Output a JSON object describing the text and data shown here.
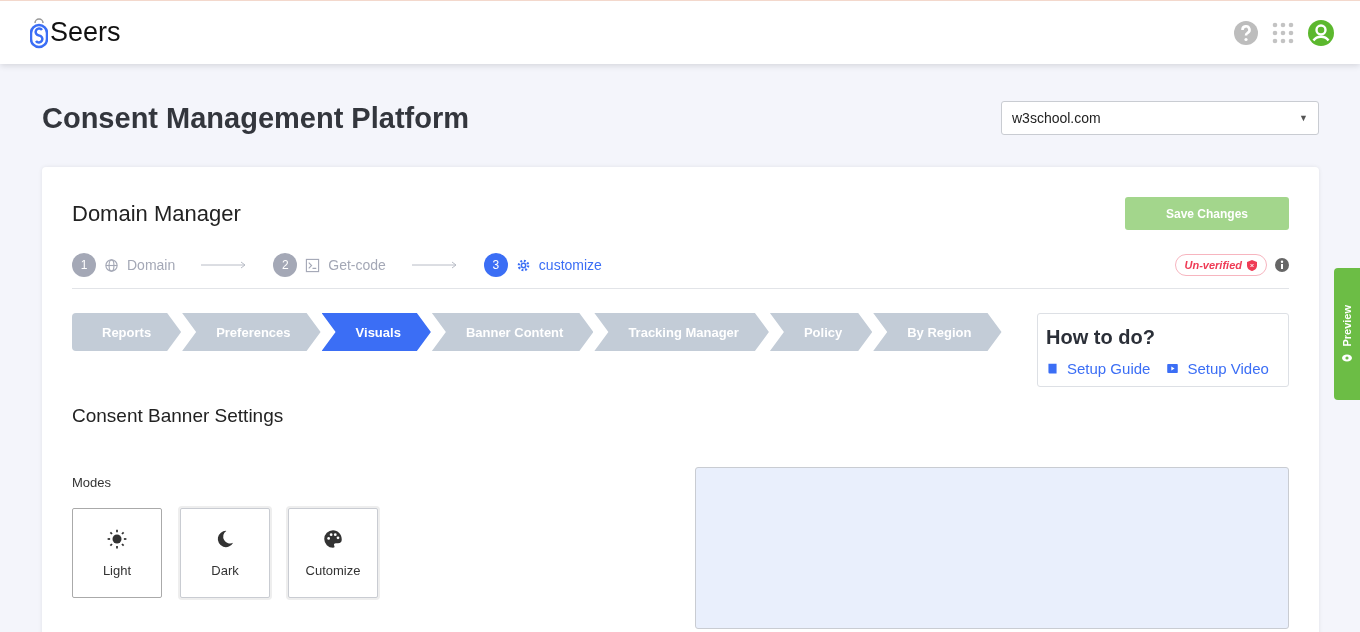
{
  "header": {
    "logo": "Seers"
  },
  "page_title": "Consent Management Platform",
  "domain_select": {
    "value": "w3school.com",
    "caret": "▼"
  },
  "card": {
    "title": "Domain Manager",
    "save_button": "Save Changes",
    "save_disabled": true,
    "steps": [
      {
        "number": "1",
        "label": "Domain",
        "selected": false
      },
      {
        "number": "2",
        "label": "Get-code",
        "selected": false
      },
      {
        "number": "3",
        "label": "customize",
        "selected": true
      }
    ],
    "status_badge": "Un-verified",
    "tabs": [
      {
        "label": "Reports",
        "selected": false
      },
      {
        "label": "Preferences",
        "selected": false
      },
      {
        "label": "Visuals",
        "selected": true
      },
      {
        "label": "Banner Content",
        "selected": false
      },
      {
        "label": "Tracking Manager",
        "selected": false
      },
      {
        "label": "Policy",
        "selected": false
      },
      {
        "label": "By Region",
        "selected": false
      }
    ],
    "help": {
      "title": "How to do?",
      "links": [
        {
          "label": "Setup Guide"
        },
        {
          "label": "Setup Video"
        }
      ]
    },
    "section_title": "Consent Banner Settings",
    "modes_label": "Modes",
    "modes": [
      {
        "label": "Light",
        "selected": true
      },
      {
        "label": "Dark",
        "selected": false
      },
      {
        "label": "Cutomize",
        "selected": false
      }
    ]
  },
  "preview_tab": "Preview"
}
